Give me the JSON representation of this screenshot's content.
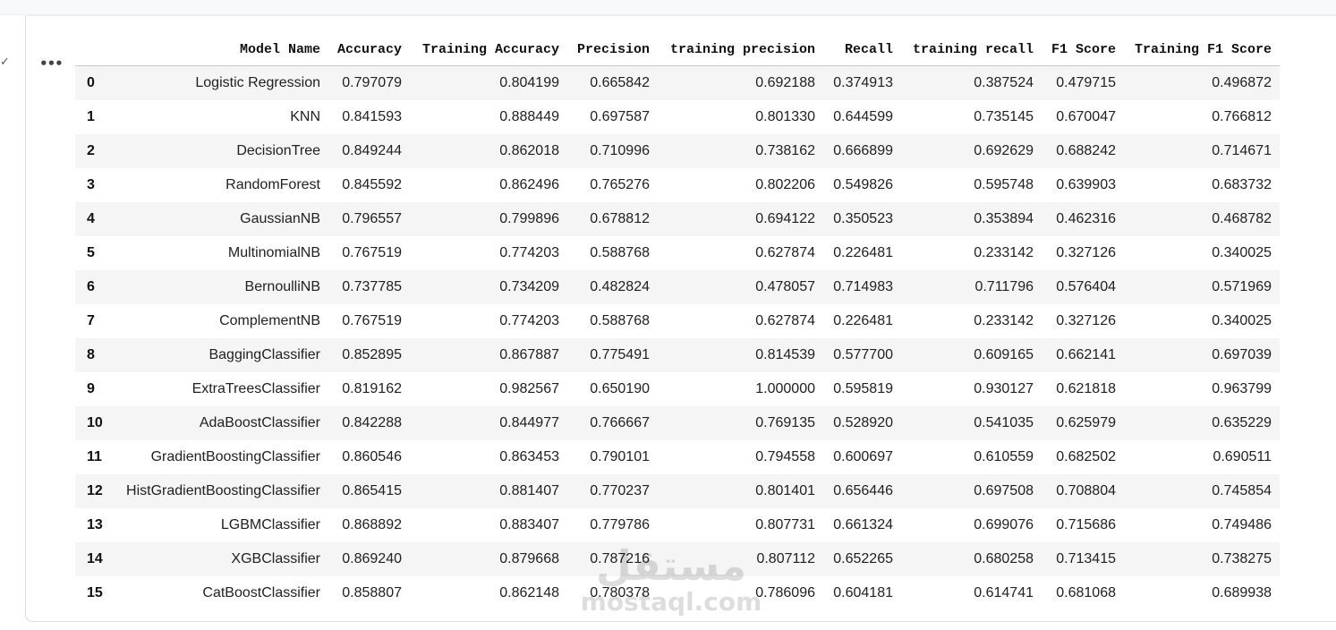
{
  "dataframe": {
    "columns": [
      "",
      "Model Name",
      "Accuracy",
      "Training Accuracy",
      "Precision",
      "training precision",
      "Recall",
      "training recall",
      "F1 Score",
      "Training F1 Score"
    ],
    "rows": [
      [
        "0",
        "Logistic Regression",
        "0.797079",
        "0.804199",
        "0.665842",
        "0.692188",
        "0.374913",
        "0.387524",
        "0.479715",
        "0.496872"
      ],
      [
        "1",
        "KNN",
        "0.841593",
        "0.888449",
        "0.697587",
        "0.801330",
        "0.644599",
        "0.735145",
        "0.670047",
        "0.766812"
      ],
      [
        "2",
        "DecisionTree",
        "0.849244",
        "0.862018",
        "0.710996",
        "0.738162",
        "0.666899",
        "0.692629",
        "0.688242",
        "0.714671"
      ],
      [
        "3",
        "RandomForest",
        "0.845592",
        "0.862496",
        "0.765276",
        "0.802206",
        "0.549826",
        "0.595748",
        "0.639903",
        "0.683732"
      ],
      [
        "4",
        "GaussianNB",
        "0.796557",
        "0.799896",
        "0.678812",
        "0.694122",
        "0.350523",
        "0.353894",
        "0.462316",
        "0.468782"
      ],
      [
        "5",
        "MultinomialNB",
        "0.767519",
        "0.774203",
        "0.588768",
        "0.627874",
        "0.226481",
        "0.233142",
        "0.327126",
        "0.340025"
      ],
      [
        "6",
        "BernoulliNB",
        "0.737785",
        "0.734209",
        "0.482824",
        "0.478057",
        "0.714983",
        "0.711796",
        "0.576404",
        "0.571969"
      ],
      [
        "7",
        "ComplementNB",
        "0.767519",
        "0.774203",
        "0.588768",
        "0.627874",
        "0.226481",
        "0.233142",
        "0.327126",
        "0.340025"
      ],
      [
        "8",
        "BaggingClassifier",
        "0.852895",
        "0.867887",
        "0.775491",
        "0.814539",
        "0.577700",
        "0.609165",
        "0.662141",
        "0.697039"
      ],
      [
        "9",
        "ExtraTreesClassifier",
        "0.819162",
        "0.982567",
        "0.650190",
        "1.000000",
        "0.595819",
        "0.930127",
        "0.621818",
        "0.963799"
      ],
      [
        "10",
        "AdaBoostClassifier",
        "0.842288",
        "0.844977",
        "0.766667",
        "0.769135",
        "0.528920",
        "0.541035",
        "0.625979",
        "0.635229"
      ],
      [
        "11",
        "GradientBoostingClassifier",
        "0.860546",
        "0.863453",
        "0.790101",
        "0.794558",
        "0.600697",
        "0.610559",
        "0.682502",
        "0.690511"
      ],
      [
        "12",
        "HistGradientBoostingClassifier",
        "0.865415",
        "0.881407",
        "0.770237",
        "0.801401",
        "0.656446",
        "0.697508",
        "0.708804",
        "0.745854"
      ],
      [
        "13",
        "LGBMClassifier",
        "0.868892",
        "0.883407",
        "0.779786",
        "0.807731",
        "0.661324",
        "0.699076",
        "0.715686",
        "0.749486"
      ],
      [
        "14",
        "XGBClassifier",
        "0.869240",
        "0.879668",
        "0.787216",
        "0.807112",
        "0.652265",
        "0.680258",
        "0.713415",
        "0.738275"
      ],
      [
        "15",
        "CatBoostClassifier",
        "0.858807",
        "0.862148",
        "0.780378",
        "0.786096",
        "0.604181",
        "0.614741",
        "0.681068",
        "0.689938"
      ]
    ]
  },
  "cell": {
    "status_icon": "check-icon",
    "status_glyph": "✓",
    "menu_icon": "more-horizontal-icon",
    "menu_glyph": "•••"
  },
  "watermark": {
    "logo_text": "مستقل",
    "site_text": "mostaql.com"
  }
}
